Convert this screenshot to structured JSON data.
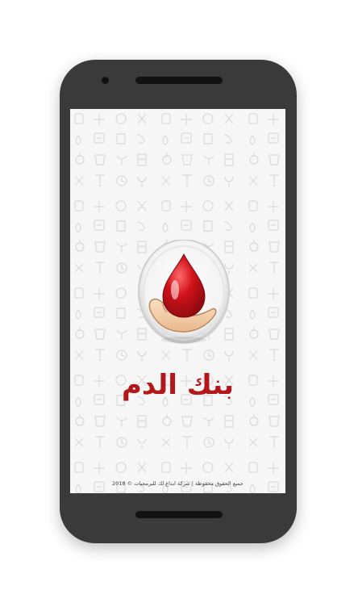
{
  "app": {
    "name": "بنك الدم"
  },
  "footer": {
    "copyright": "جميع الحقوق محفوظة | شركة ابداع لك للبرمجيات © 2018"
  },
  "colors": {
    "brand_red": "#b3161b",
    "phone_body": "#3a3a3a",
    "screen_bg": "#f6f6f6"
  },
  "icons": {
    "logo": "blood-drop-in-hand-icon",
    "background": "medical-icons-pattern"
  }
}
